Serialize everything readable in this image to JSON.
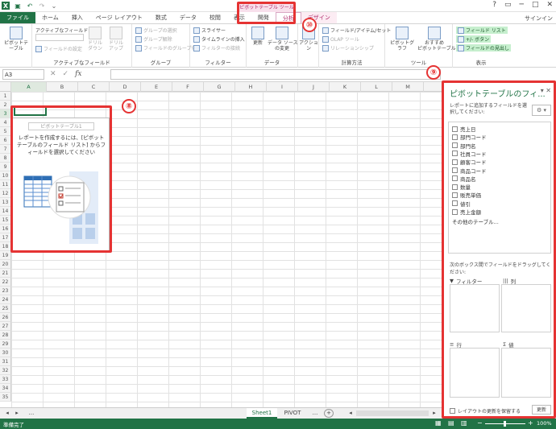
{
  "titlebar": {
    "ctx_group": "ピボットテーブル ツール",
    "window_controls": [
      "?",
      "▭",
      "─",
      "□",
      "✕"
    ]
  },
  "tabs": [
    {
      "label": "ファイル",
      "kind": "file"
    },
    {
      "label": "ホーム",
      "kind": "normal"
    },
    {
      "label": "挿入",
      "kind": "normal"
    },
    {
      "label": "ページ レイアウト",
      "kind": "normal"
    },
    {
      "label": "数式",
      "kind": "normal"
    },
    {
      "label": "データ",
      "kind": "normal"
    },
    {
      "label": "校閲",
      "kind": "normal"
    },
    {
      "label": "表示",
      "kind": "normal"
    },
    {
      "label": "開発",
      "kind": "normal"
    },
    {
      "label": "分析",
      "kind": "ctx-active"
    },
    {
      "label": "デザイン",
      "kind": "ctx"
    }
  ],
  "signin": "サインイン",
  "ribbon": {
    "pivot": {
      "btn": "ピボットテーブル",
      "label": ""
    },
    "active_field": {
      "title": "アクティブなフィールド:",
      "settings": "フィールドの設定",
      "drill_down": "ドリル\nダウン",
      "drill_up": "ドリル\nアップ",
      "label": "アクティブなフィールド"
    },
    "group": {
      "sel": "グループの選択",
      "ungroup": "グループ解除",
      "field_group": "フィールドのグループ化",
      "label": "グループ"
    },
    "filter": {
      "slicer": "スライサー",
      "timeline": "タイムラインの挿入",
      "conn": "フィルターの接続",
      "label": "フィルター"
    },
    "data": {
      "refresh": "更新",
      "change_source": "データ ソース\nの変更",
      "label": "データ"
    },
    "actions": {
      "btn": "アクション"
    },
    "calc": {
      "fields": "フィールド/アイテム/セット",
      "olap": "OLAP ツール",
      "rel": "リレーションシップ",
      "label": "計算方法"
    },
    "tools": {
      "chart": "ピボットグラフ",
      "recommended": "おすすめ\nピボットテーブル",
      "label": "ツール"
    },
    "show": {
      "field_list": "フィールド リスト",
      "buttons": "+/- ボタン",
      "headers": "フィールドの見出し",
      "label": "表示"
    }
  },
  "formula": {
    "namebox": "A3",
    "fx": "fx",
    "value": ""
  },
  "columns": [
    "A",
    "B",
    "C",
    "D",
    "E",
    "F",
    "G",
    "H",
    "I",
    "J",
    "K",
    "L",
    "M"
  ],
  "rows": [
    "1",
    "2",
    "3",
    "4",
    "5",
    "6",
    "7",
    "8",
    "9",
    "10",
    "11",
    "12",
    "13",
    "14",
    "15",
    "16",
    "17",
    "18",
    "19",
    "20",
    "21",
    "22",
    "23",
    "24",
    "25",
    "26",
    "27",
    "28",
    "29",
    "30",
    "31",
    "32",
    "33",
    "34",
    "35"
  ],
  "placeholder": {
    "title": "ピボットテーブル1",
    "message": "レポートを作成するには、[ピボットテーブルのフィールド リスト] からフィールドを選択してください"
  },
  "callouts": [
    "⑧",
    "⑨",
    "⑩"
  ],
  "pane": {
    "title": "ピボットテーブルのフィ...",
    "prompt": "レポートに追加するフィールドを選択してください:",
    "fields": [
      "売上日",
      "部門コード",
      "部門名",
      "社員コード",
      "顧客コード",
      "商品コード",
      "商品名",
      "数量",
      "販売単価",
      "値引",
      "売上金額"
    ],
    "more": "その他のテーブル...",
    "drag_prompt": "次のボックス間でフィールドをドラッグしてください:",
    "areas": {
      "filter": "フィルター",
      "columns": "列",
      "rows": "行",
      "values": "値"
    },
    "defer": "レイアウトの更新を保留する",
    "update": "更新"
  },
  "sheets": {
    "nav_ellipsis": "...",
    "tabs": [
      "Sheet1",
      "PIVOT",
      "..."
    ],
    "active": "Sheet1"
  },
  "status": {
    "ready": "準備完了",
    "zoom": "100%"
  }
}
